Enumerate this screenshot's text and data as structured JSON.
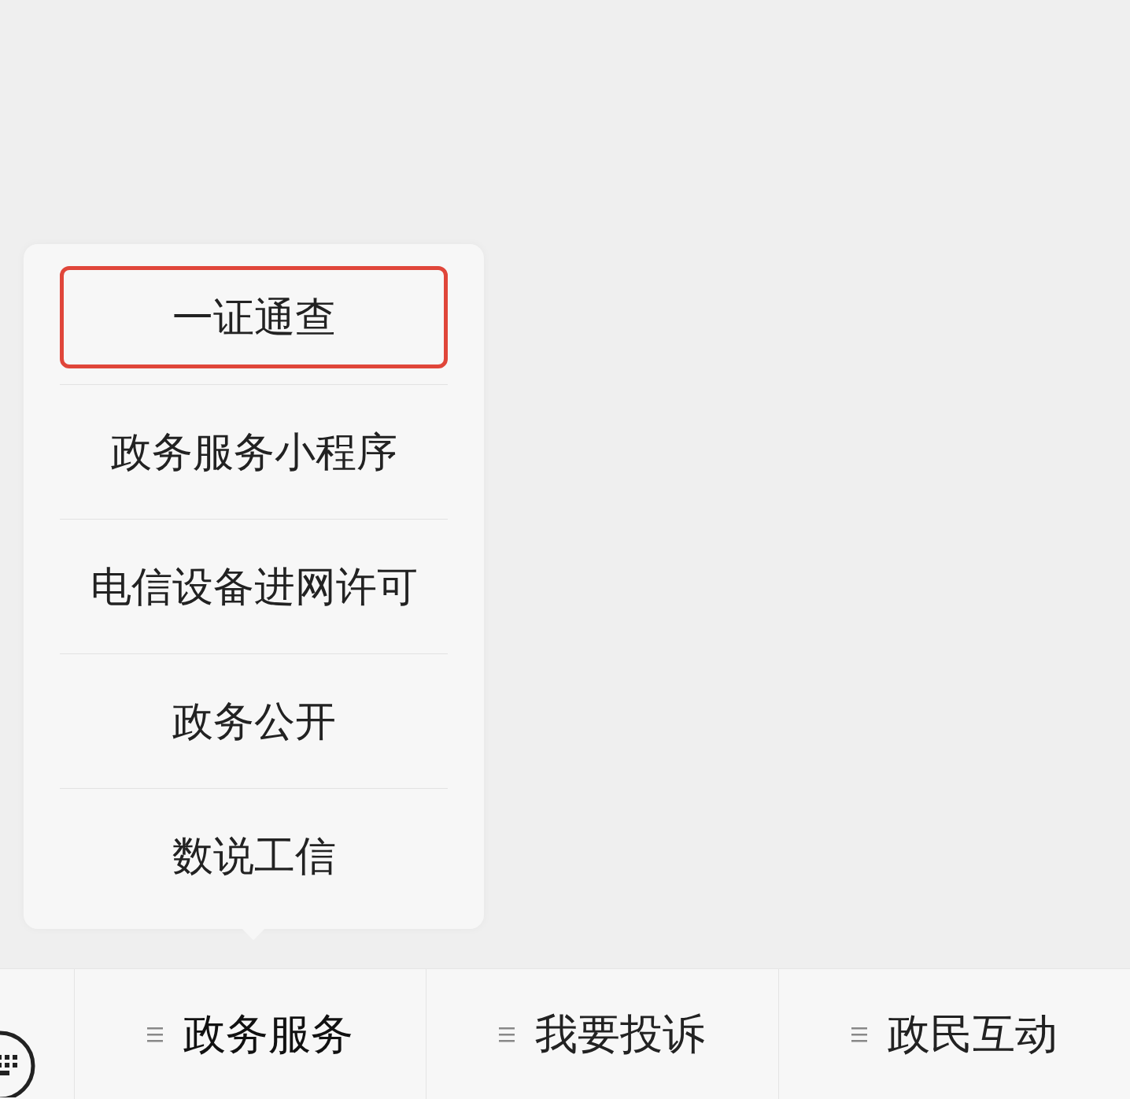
{
  "menu_popup": {
    "items": [
      {
        "label": "一证通查",
        "highlighted": true
      },
      {
        "label": "政务服务小程序",
        "highlighted": false
      },
      {
        "label": "电信设备进网许可",
        "highlighted": false
      },
      {
        "label": "政务公开",
        "highlighted": false
      },
      {
        "label": "数说工信",
        "highlighted": false
      }
    ]
  },
  "bottom_menu": {
    "items": [
      {
        "label": "政务服务",
        "selected": true
      },
      {
        "label": "我要投诉",
        "selected": false
      },
      {
        "label": "政民互动",
        "selected": false
      }
    ]
  }
}
